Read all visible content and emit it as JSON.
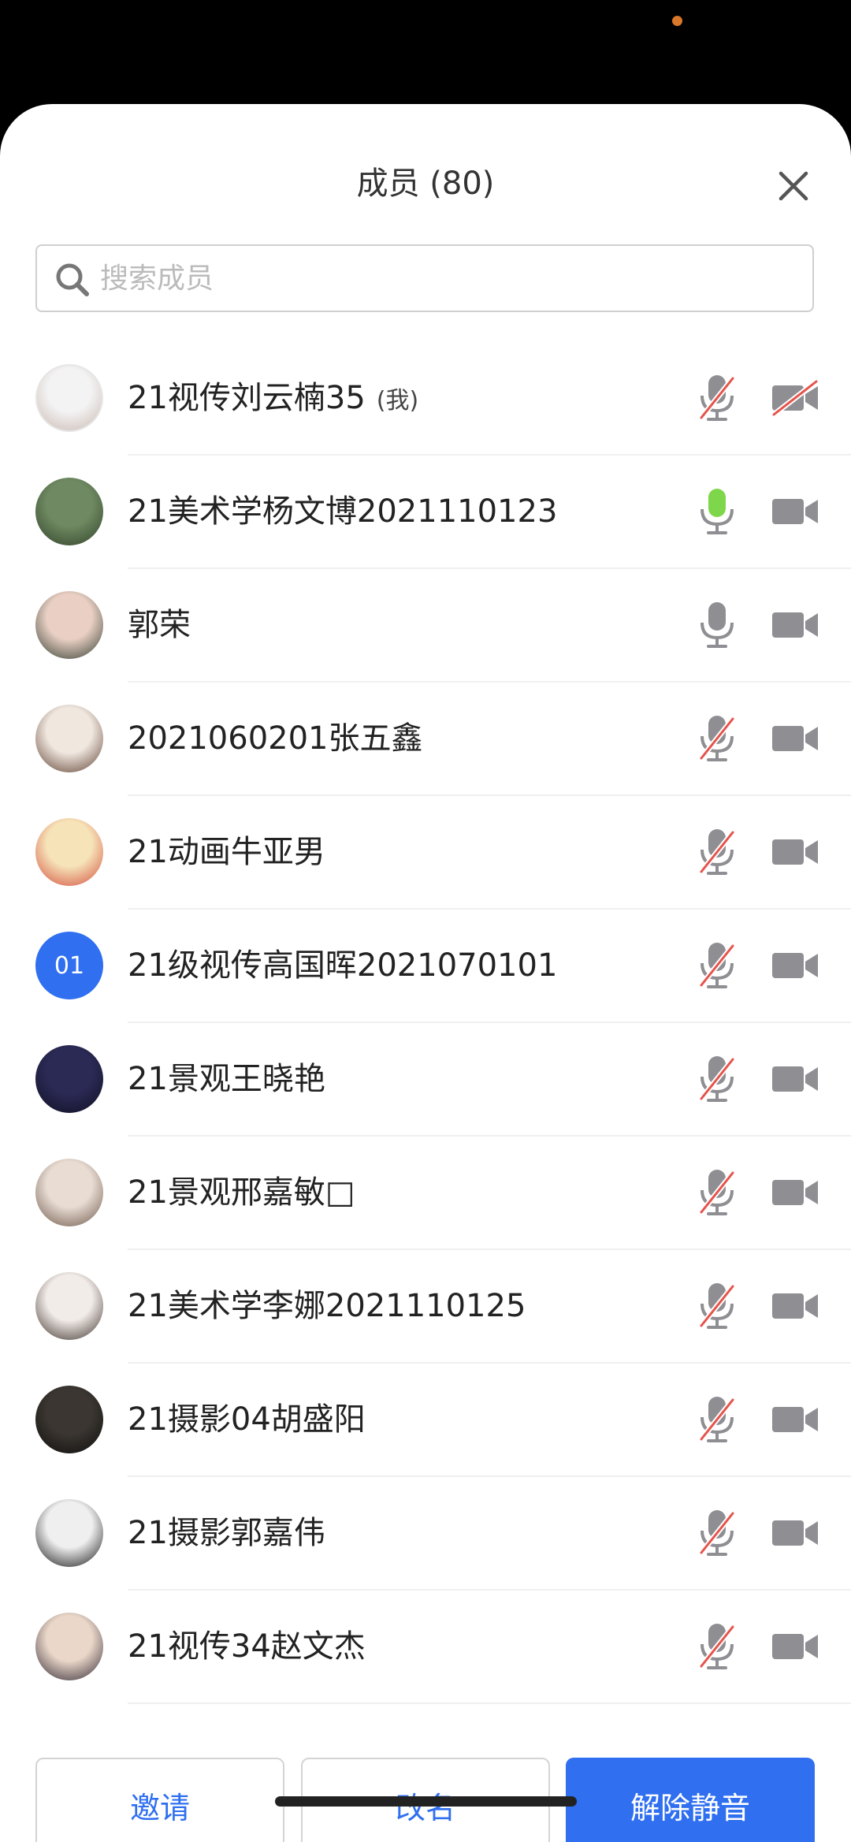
{
  "header": {
    "title": "成员 (80)"
  },
  "search": {
    "placeholder": "搜索成员",
    "value": ""
  },
  "self_suffix": "(我)",
  "members": [
    {
      "name": "21视传刘云楠35",
      "mic": "muted",
      "camera": "off",
      "avatar_colors": [
        "#f3f3f3",
        "#c9b7b0"
      ],
      "is_self": true
    },
    {
      "name": "21美术学杨文博2021110123",
      "mic": "speaking",
      "camera": "on",
      "avatar_colors": [
        "#6f8a62",
        "#2f4028"
      ]
    },
    {
      "name": "郭荣",
      "mic": "on",
      "camera": "on",
      "avatar_colors": [
        "#e9cfc4",
        "#2e3a2c"
      ]
    },
    {
      "name": "2021060201张五鑫",
      "mic": "muted",
      "camera": "on",
      "avatar_colors": [
        "#f0e7df",
        "#5c3d2e"
      ]
    },
    {
      "name": "21动画牛亚男",
      "mic": "muted",
      "camera": "on",
      "avatar_colors": [
        "#f6e3b8",
        "#d24a3a"
      ]
    },
    {
      "name": "21级视传高国晖2021070101",
      "mic": "muted",
      "camera": "on",
      "avatar_text": "01",
      "avatar_colors": [
        "#2f6ff0",
        "#2f6ff0"
      ]
    },
    {
      "name": "21景观王晓艳",
      "mic": "muted",
      "camera": "on",
      "avatar_colors": [
        "#2b2a55",
        "#0f0f22"
      ]
    },
    {
      "name": "21景观邢嘉敏□",
      "mic": "muted",
      "camera": "on",
      "avatar_colors": [
        "#e8dcd3",
        "#6b5446"
      ]
    },
    {
      "name": "21美术学李娜2021110125",
      "mic": "muted",
      "camera": "on",
      "avatar_colors": [
        "#f2ece8",
        "#3a2d28"
      ]
    },
    {
      "name": "21摄影04胡盛阳",
      "mic": "muted",
      "camera": "on",
      "avatar_colors": [
        "#3b3631",
        "#0e0d0c"
      ]
    },
    {
      "name": "21摄影郭嘉伟",
      "mic": "muted",
      "camera": "on",
      "avatar_colors": [
        "#efefef",
        "#111111"
      ]
    },
    {
      "name": "21视传34赵文杰",
      "mic": "muted",
      "camera": "on",
      "avatar_colors": [
        "#ead7c9",
        "#2c2430"
      ]
    }
  ],
  "buttons": {
    "invite": "邀请",
    "rename": "改名",
    "unmute": "解除静音"
  },
  "colors": {
    "accent": "#2f6ff0",
    "icon_gray": "#8e8e93",
    "mute_slash": "#e5534b",
    "speaking_green": "#7ed64a"
  },
  "icons": {
    "close": "close-icon",
    "search": "search-icon",
    "mic": "microphone-icon",
    "mic_muted": "microphone-muted-icon",
    "camera": "video-camera-icon",
    "camera_off": "video-camera-off-icon"
  }
}
